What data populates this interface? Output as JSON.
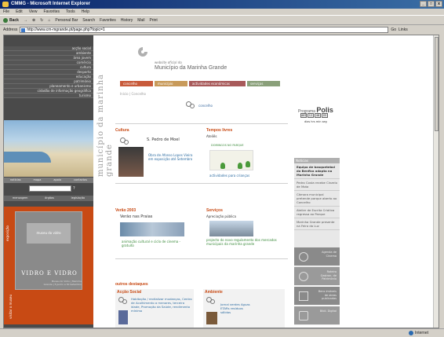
{
  "window": {
    "title": "CMMG - Microsoft Internet Explorer",
    "buttons": [
      "_",
      "□",
      "x"
    ]
  },
  "menu": [
    "File",
    "Edit",
    "View",
    "Favorites",
    "Tools",
    "Help"
  ],
  "toolbar": {
    "back": "Back",
    "forward": "→",
    "stop": "⊗",
    "refresh": "↻",
    "home": "⌂",
    "personal_bar": "Personal Bar",
    "search": "Search",
    "favorites": "Favorites",
    "history": "History",
    "mail": "Mail",
    "print": "Print"
  },
  "address": {
    "label": "Address",
    "url": "http://www.cm-mgrande.pt/page.php?topic=1",
    "go": "Go",
    "links": "Links"
  },
  "status": {
    "text": "",
    "zone": "Internet"
  },
  "sidebar": {
    "nav": [
      "acção social",
      "ambiente",
      "área jovem",
      "comércio",
      "cultura",
      "desporto",
      "educação",
      "património",
      "planeamento e urbanismo",
      "cidadão de informação geográfica",
      "turismo"
    ],
    "vertical_title": "município da marinha grande",
    "quicklinks": [
      "notícias",
      "mapa",
      "apoio",
      "contactos"
    ],
    "search_go": "?",
    "links2": [
      "mensagem",
      "órgãos",
      "legislação"
    ],
    "promo_label": "exposição",
    "promo_vertical": "visitar o museu",
    "promo_card_logo": "museu do vidro",
    "promo_card_title": "VIDRO E VIDRO",
    "promo_card_small": "Museu do Vidro | Marinha Grande | 5 Junho a 30 Setembro"
  },
  "header": {
    "subtitle": "website oficial do",
    "title": "Município da Marinha Grande"
  },
  "tabs": [
    "concelho",
    "município",
    "actividades económicas",
    "serviços"
  ],
  "crumb": "Início | Concelho",
  "concelho_link": "concelho",
  "cultura": {
    "title": "Cultura",
    "subtitle": "S. Pedro de Moel",
    "text": "Obra de Afonso Lopes Vieira em exposição até Setembro"
  },
  "tempos_livres": {
    "title": "Tempos livres",
    "sub": "Ateliês",
    "banner": "DOMINGOS NO PARQUE",
    "link": "actividades para crianças"
  },
  "verao": {
    "title": "Verão 2003",
    "sub": "Verão nas Praias",
    "text": "animação cultural e ciclo de cinema - gratuito"
  },
  "servicos": {
    "title": "Serviços",
    "sub": "Apreciação pública",
    "text": "projecto do novo regulamento dos mercados municipais da marinha grande"
  },
  "outros": {
    "title": "outros destaques"
  },
  "accao": {
    "title": "Acção Social",
    "text": "Habitação / revitalizar mudanças, Centro de Acolhimento a menores, terceira idade, Promoção da Saúde, rendimento mínimo"
  },
  "ambiente": {
    "title": "Ambiente",
    "text": "Jornal verdes Aguas ETARs resíduos sólidos"
  },
  "pols": {
    "prefix": "Programa",
    "name": "Polis",
    "counter": [
      "487",
      "12",
      "48",
      "05"
    ],
    "label": "dias hrs min seg"
  },
  "noticias": {
    "header": "Notícias",
    "items": [
      "Equipa de basquetebol do Benfica adapta na Marinha Grande",
      "Pedro Costa recebe Cinzelo de Mota",
      "Câmara municipal pretende parque aberto ao Concelho",
      "Atelier de Escrita Criativa regressa ao Parque",
      "Marinha Grande presente na Feira da Luz"
    ]
  },
  "rbtns": [
    {
      "label": "Agenda de Cinema"
    },
    {
      "label": "Roteiro Gastron. de Património"
    },
    {
      "label": "Bens imóveis de obras publicadas"
    },
    {
      "label": "Bibli. Digital"
    }
  ]
}
